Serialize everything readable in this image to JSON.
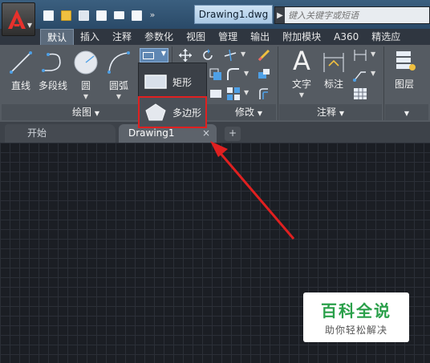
{
  "title_bar": {
    "document_title": "Drawing1.dwg",
    "search_placeholder": "键入关键字或短语",
    "qat_icons": [
      "new-file-icon",
      "open-folder-icon",
      "save-icon",
      "save-as-icon",
      "print-icon",
      "undo-icon",
      "overflow-chevron-icon"
    ]
  },
  "ribbon_tabs": [
    "默认",
    "插入",
    "注释",
    "参数化",
    "视图",
    "管理",
    "输出",
    "附加模块",
    "A360",
    "精选应"
  ],
  "active_tab": "默认",
  "draw_panel": {
    "buttons": [
      "直线",
      "多段线",
      "圆",
      "圆弧"
    ],
    "panel_label": "绘图"
  },
  "modify_panel": {
    "panel_label": "修改"
  },
  "annotation_panel": {
    "buttons": [
      "文字",
      "标注"
    ],
    "panel_label": "注释"
  },
  "layers_panel": {
    "button": "图层"
  },
  "flyout": {
    "items": [
      "矩形",
      "多边形"
    ],
    "highlighted": "多边形"
  },
  "doc_tabs": {
    "start": "开始",
    "drawing": "Drawing1",
    "close_glyph": "×",
    "add_glyph": "+"
  },
  "watermark": {
    "title": "百科全说",
    "subtitle": "助你轻松解决"
  },
  "colors": {
    "accent_red": "#e02020",
    "ribbon_bg": "#555b62",
    "canvas_bg": "#1b1e24",
    "watermark_green": "#2aa04a"
  }
}
